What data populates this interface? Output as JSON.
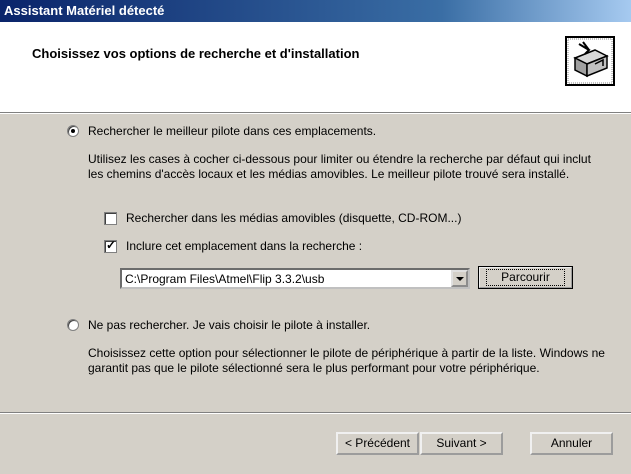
{
  "window": {
    "title": "Assistant Matériel détecté"
  },
  "header": {
    "title": "Choisissez vos options de recherche et d'installation",
    "icon": "hardware-wizard-icon"
  },
  "option_search": {
    "label": "Rechercher le meilleur pilote dans ces emplacements.",
    "selected": true,
    "description": "Utilisez les cases à cocher ci-dessous pour limiter ou étendre la recherche par défaut qui inclut les chemins d'accès locaux et les médias amovibles. Le meilleur pilote trouvé sera installé.",
    "check_removable": {
      "label": "Rechercher dans les médias amovibles (disquette, CD-ROM...)",
      "checked": false
    },
    "check_include": {
      "label": "Inclure cet emplacement dans la recherche :",
      "checked": true
    },
    "path_value": "C:\\Program Files\\Atmel\\Flip 3.3.2\\usb",
    "browse_label": "Parcourir"
  },
  "option_manual": {
    "label": "Ne pas rechercher. Je vais choisir le pilote à installer.",
    "selected": false,
    "description": "Choisissez cette option pour sélectionner le pilote de périphérique à partir de la liste. Windows ne garantit pas que le pilote sélectionné sera le plus performant pour votre périphérique."
  },
  "buttons": {
    "back": "< Précédent",
    "next": "Suivant >",
    "cancel": "Annuler"
  }
}
